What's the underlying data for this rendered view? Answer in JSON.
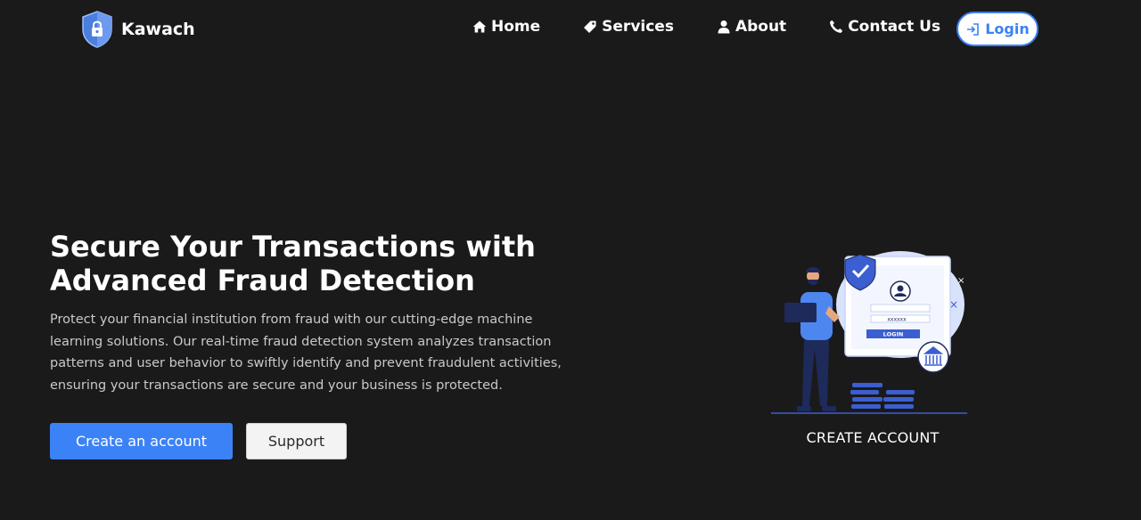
{
  "brand": {
    "name": "Kawach",
    "logo_icon": "shield-lock-icon"
  },
  "nav": {
    "items": [
      {
        "label": "Home",
        "icon": "home-icon"
      },
      {
        "label": "Services",
        "icon": "tag-icon"
      },
      {
        "label": "About",
        "icon": "user-icon"
      },
      {
        "label": "Contact Us",
        "icon": "phone-icon"
      }
    ],
    "login_label": "Login",
    "login_icon": "sign-in-icon"
  },
  "hero": {
    "title": "Secure Your Transactions with Advanced Fraud Detection",
    "description": "Protect your financial institution from fraud with our cutting-edge machine learning solutions. Our real-time fraud detection system analyzes transaction patterns and user behavior to swiftly identify and prevent fraudulent activities, ensuring your transactions are secure and your business is protected.",
    "primary_button": "Create an account",
    "secondary_button": "Support"
  },
  "illustration": {
    "caption": "CREATE ACCOUNT",
    "password_mask": "xxxxxx",
    "login_text": "LOGIN"
  },
  "colors": {
    "background": "#1b1a1b",
    "accent": "#3b82f6",
    "text": "#ffffff",
    "muted_text": "#c9c9c9"
  }
}
